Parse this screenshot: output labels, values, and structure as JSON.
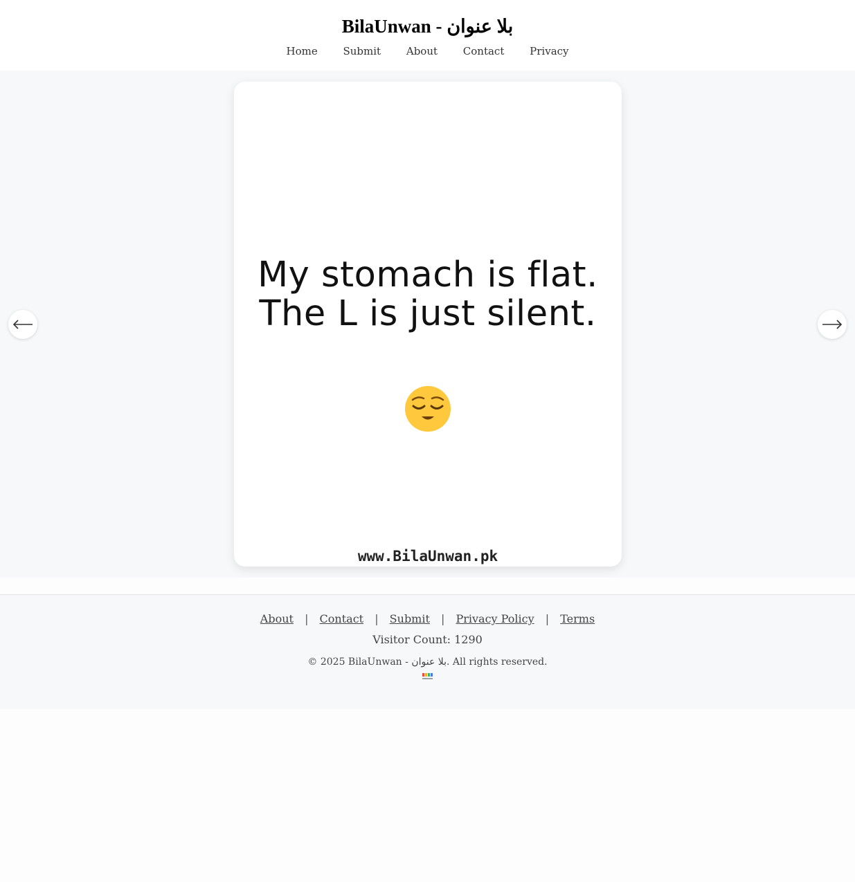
{
  "header": {
    "title": "BilaUnwan - بلا عنوان",
    "nav": [
      "Home",
      "Submit",
      "About",
      "Contact",
      "Privacy"
    ]
  },
  "slide": {
    "joke": "My stomach is flat. The L is just silent.",
    "watermark": "www.BilaUnwan.pk",
    "emoji_icon": "relieved-face-icon"
  },
  "controls": {
    "prev_icon": "left-arrow-icon",
    "next_icon": "right-arrow-icon"
  },
  "footer": {
    "links": [
      "About",
      "Contact",
      "Submit",
      "Privacy Policy",
      "Terms"
    ],
    "separator": "|",
    "visitor_count": "Visitor Count: 1290",
    "copyright": "© 2025 BilaUnwan - بلا عنوان. All rights reserved."
  },
  "colors": {
    "stage_bg": "#f7f8fa",
    "emoji_yellow": "#ffc83d"
  }
}
